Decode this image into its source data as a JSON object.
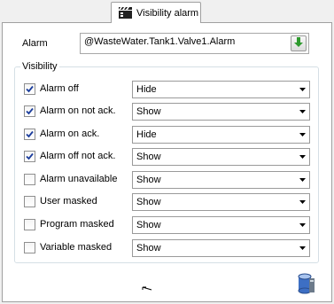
{
  "tab": {
    "label": "Visibility alarm",
    "icon": "clapperboard-icon"
  },
  "alarm": {
    "label": "Alarm",
    "value": "@WasteWater.Tank1.Valve1.Alarm",
    "browse_icon": "green-down-arrow-icon"
  },
  "visibility": {
    "title": "Visibility",
    "rows": [
      {
        "label": "Alarm off",
        "checked": true,
        "value": "Hide"
      },
      {
        "label": "Alarm on not ack.",
        "checked": true,
        "value": "Show"
      },
      {
        "label": "Alarm on ack.",
        "checked": true,
        "value": "Hide"
      },
      {
        "label": "Alarm off not ack.",
        "checked": true,
        "value": "Show"
      },
      {
        "label": "Alarm unavailable",
        "checked": false,
        "value": "Show"
      },
      {
        "label": "User masked",
        "checked": false,
        "value": "Show"
      },
      {
        "label": "Program masked",
        "checked": false,
        "value": "Show"
      },
      {
        "label": "Variable masked",
        "checked": false,
        "value": "Show"
      }
    ]
  },
  "footer": {
    "database_icon": "database-icon"
  },
  "colors": {
    "check": "#1a3c9c",
    "accent_green": "#2e9a2e",
    "db_blue": "#3d6fc4"
  }
}
